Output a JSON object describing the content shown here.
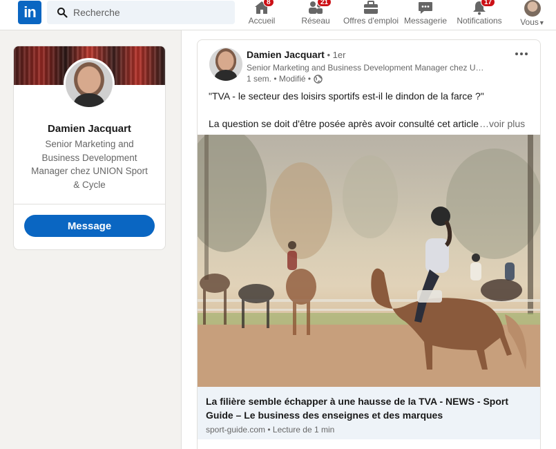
{
  "nav": {
    "logo_text": "in",
    "search_placeholder": "Recherche",
    "items": [
      {
        "label": "Accueil",
        "badge": "8"
      },
      {
        "label": "Réseau",
        "badge": "21"
      },
      {
        "label": "Offres d'emploi",
        "badge": ""
      },
      {
        "label": "Messagerie",
        "badge": ""
      },
      {
        "label": "Notifications",
        "badge": "17"
      },
      {
        "label": "Vous"
      }
    ]
  },
  "profile": {
    "name": "Damien Jacquart",
    "headline": "Senior Marketing and Business Development Manager chez UNION Sport & Cycle",
    "message_button": "Message"
  },
  "post": {
    "author": "Damien Jacquart",
    "degree": " • 1er",
    "headline": "Senior Marketing and Business Development Manager chez UNIO...",
    "meta": "1 sem. • Modifié •",
    "text_line1": "\"TVA - le secteur des loisirs sportifs est-il le dindon de la farce ?\"",
    "text_line2": "La question se doit d'être posée après avoir consulté cet article qui",
    "see_more": "…voir plus",
    "link_title": "La filière semble échapper à une hausse de la TVA - NEWS - Sport Guide – Le business des enseignes et des marques",
    "link_source": "sport-guide.com • Lecture de 1 min"
  },
  "colors": {
    "brand": "#0a66c2",
    "badge": "#cc1016",
    "link_box": "#eef3f8"
  }
}
